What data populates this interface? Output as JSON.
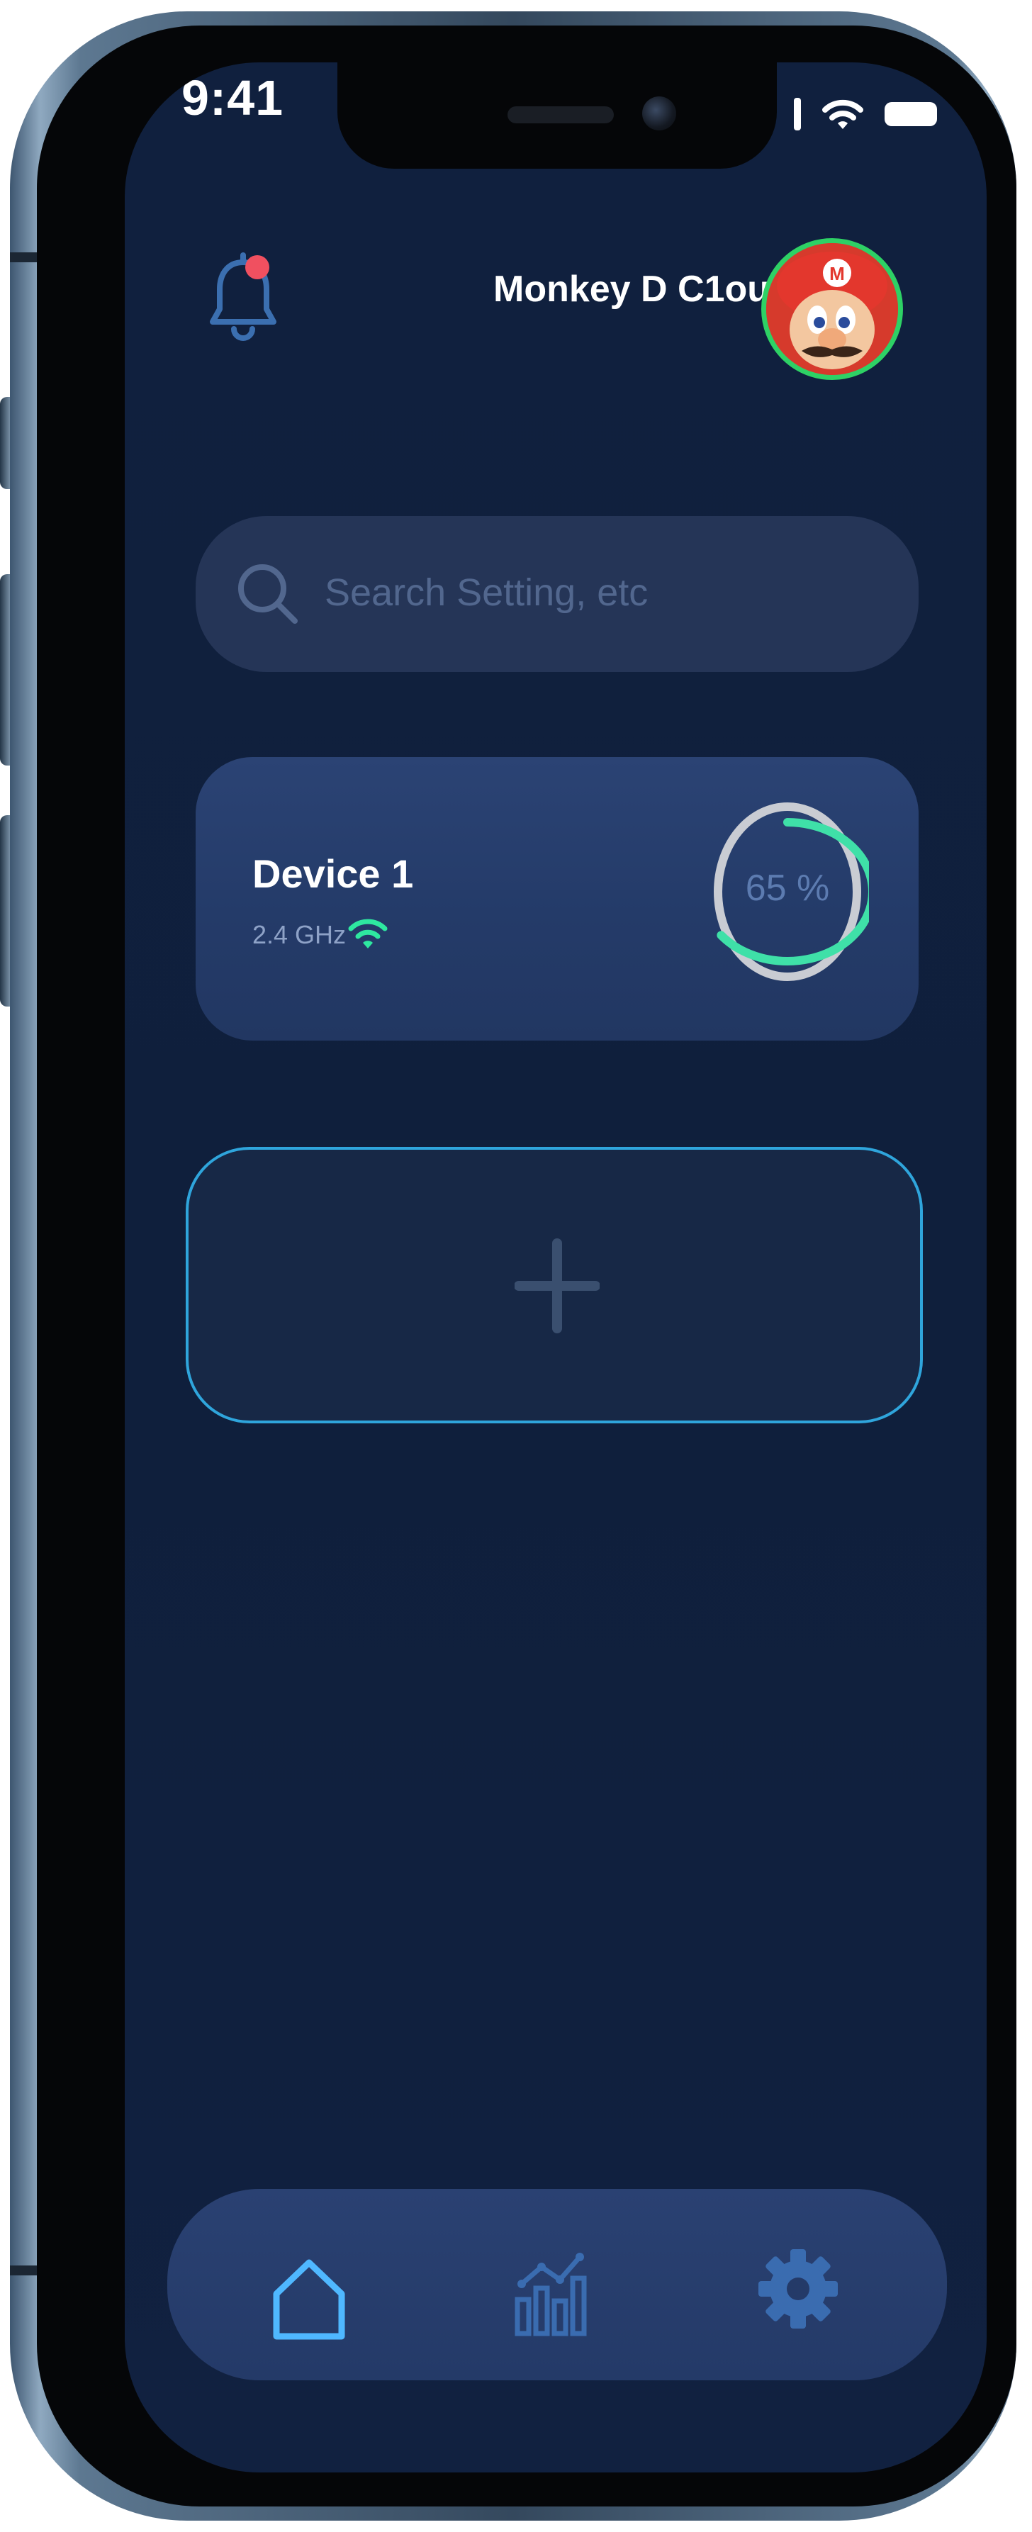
{
  "status_bar": {
    "time": "9:41"
  },
  "header": {
    "username": "Monkey D C1oud",
    "notification_badge_color": "#f05060",
    "avatar_ring_color": "#2ed165"
  },
  "search": {
    "placeholder": "Search Setting, etc",
    "value": ""
  },
  "device_card": {
    "name": "Device 1",
    "band": "2.4 GHz",
    "wifi_color": "#2ee8a0",
    "progress_label": "65 %",
    "progress_value": 0.65,
    "progress_color": "#3fe0a8"
  },
  "add_card": {
    "icon": "plus-icon",
    "border_color": "#2fa5dc"
  },
  "bottom_nav": {
    "items": [
      {
        "icon": "home-icon",
        "active": true
      },
      {
        "icon": "stats-chart-icon",
        "active": false
      },
      {
        "icon": "gear-icon",
        "active": false
      }
    ],
    "active_color": "#4fb8ff",
    "inactive_color": "#3a6cb0"
  },
  "colors": {
    "screen_background": "#10203e",
    "card_background": "#2b4374",
    "search_background": "#253557"
  }
}
